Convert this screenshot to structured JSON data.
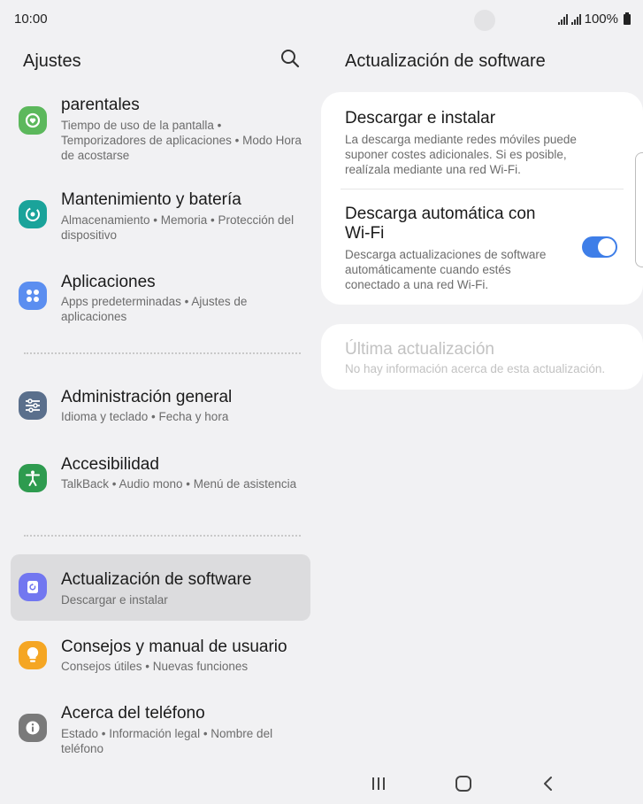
{
  "status_bar": {
    "time": "10:00",
    "battery_percent": "100%",
    "icons": [
      "signal-icon",
      "signal-icon",
      "battery-icon"
    ]
  },
  "left_pane": {
    "title": "Ajustes",
    "search_icon": "search-icon",
    "items": [
      {
        "title": "parentales",
        "subtitle": "Tiempo de uso de la pantalla  •  Temporizadores de aplicaciones  •  Modo Hora de acostarse",
        "icon": "digital-wellbeing-icon",
        "color": "#5cb85c"
      },
      {
        "title": "Mantenimiento y batería",
        "subtitle": "Almacenamiento  •  Memoria  •  Protección del dispositivo",
        "icon": "device-care-icon",
        "color": "#1aa39a"
      },
      {
        "title": "Aplicaciones",
        "subtitle": "Apps predeterminadas  •  Ajustes de aplicaciones",
        "icon": "apps-icon",
        "color": "#5b8ef0"
      },
      {
        "title": "Administración general",
        "subtitle": "Idioma y teclado  •  Fecha y hora",
        "icon": "general-management-icon",
        "color": "#5a6f8c"
      },
      {
        "title": "Accesibilidad",
        "subtitle": "TalkBack  •  Audio mono  •  Menú de asistencia",
        "icon": "accessibility-icon",
        "color": "#2e9b4f"
      },
      {
        "title": "Actualización de software",
        "subtitle": "Descargar e instalar",
        "icon": "software-update-icon",
        "color": "#7277f0"
      },
      {
        "title": "Consejos y manual de usuario",
        "subtitle": "Consejos útiles  •  Nuevas funciones",
        "icon": "tips-lightbulb-icon",
        "color": "#f5a623"
      },
      {
        "title": "Acerca del teléfono",
        "subtitle": "Estado  •  Información legal  •  Nombre del teléfono",
        "icon": "info-icon",
        "color": "#7a7a7a"
      }
    ],
    "selected_index": 5
  },
  "right_pane": {
    "title": "Actualización de software",
    "download_install": {
      "title": "Descargar e instalar",
      "subtitle": "La descarga mediante redes móviles puede suponer costes adicionales. Si es posible, realízala mediante una red Wi-Fi."
    },
    "auto_download": {
      "title": "Descarga automática con Wi-Fi",
      "subtitle": "Descarga actualizaciones de software automáticamente cuando estés conectado a una red Wi-Fi.",
      "enabled": true
    },
    "last_update": {
      "title": "Última actualización",
      "subtitle": "No hay información acerca de esta actualización."
    }
  },
  "colors": {
    "accent": "#3e7ee8",
    "background": "#f1f1f3",
    "card": "#ffffff",
    "selected_row": "#dcdcde"
  },
  "navigation_bar": [
    "recent-apps-icon",
    "home-icon",
    "back-icon"
  ]
}
